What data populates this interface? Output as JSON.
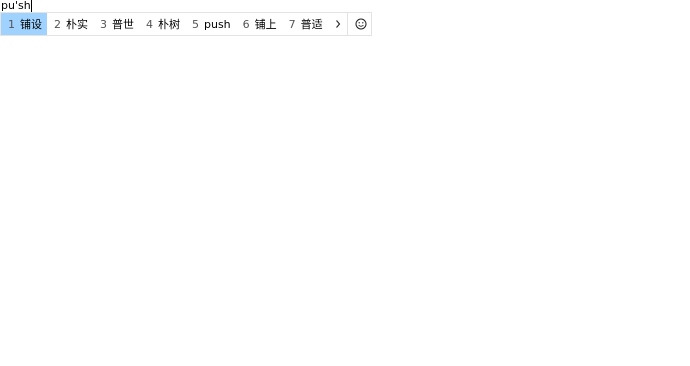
{
  "composition": {
    "text": "pu'sh"
  },
  "ime": {
    "candidates": [
      {
        "num": "1",
        "text": "铺设"
      },
      {
        "num": "2",
        "text": "朴实"
      },
      {
        "num": "3",
        "text": "普世"
      },
      {
        "num": "4",
        "text": "朴树"
      },
      {
        "num": "5",
        "text": "push"
      },
      {
        "num": "6",
        "text": "铺上"
      },
      {
        "num": "7",
        "text": "普适"
      }
    ],
    "selected_index": 0,
    "prev_icon": "chevron-left-icon",
    "next_icon": "chevron-right-icon",
    "emoji_icon": "smiley-icon",
    "colors": {
      "selected_bg": "#9fd2ff",
      "border": "#e3e3e3"
    }
  }
}
